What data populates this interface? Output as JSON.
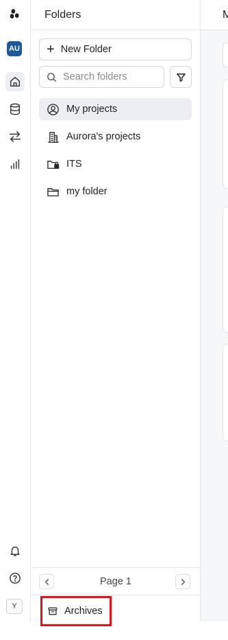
{
  "rail": {
    "icons": [
      "logo-icon",
      "home-icon",
      "database-icon",
      "transfer-icon",
      "chart-icon",
      "bell-icon",
      "help-icon"
    ],
    "org_badge": "AU",
    "user_initial": "Y"
  },
  "panel": {
    "title": "Folders",
    "new_folder_label": "New Folder",
    "search_placeholder": "Search folders",
    "folders": [
      {
        "label": "My projects",
        "icon": "user-circle-icon",
        "active": true
      },
      {
        "label": "Aurora's projects",
        "icon": "building-icon",
        "active": false
      },
      {
        "label": "ITS",
        "icon": "locked-folder-icon",
        "active": false
      },
      {
        "label": "my folder",
        "icon": "folder-icon",
        "active": false
      }
    ],
    "pager_label": "Page 1",
    "archives_label": "Archives"
  },
  "content": {
    "header_title": "M"
  },
  "colors": {
    "accent_badge": "#1d5a9c",
    "active_bg": "#eceef1",
    "highlight_border": "#e1141e"
  }
}
